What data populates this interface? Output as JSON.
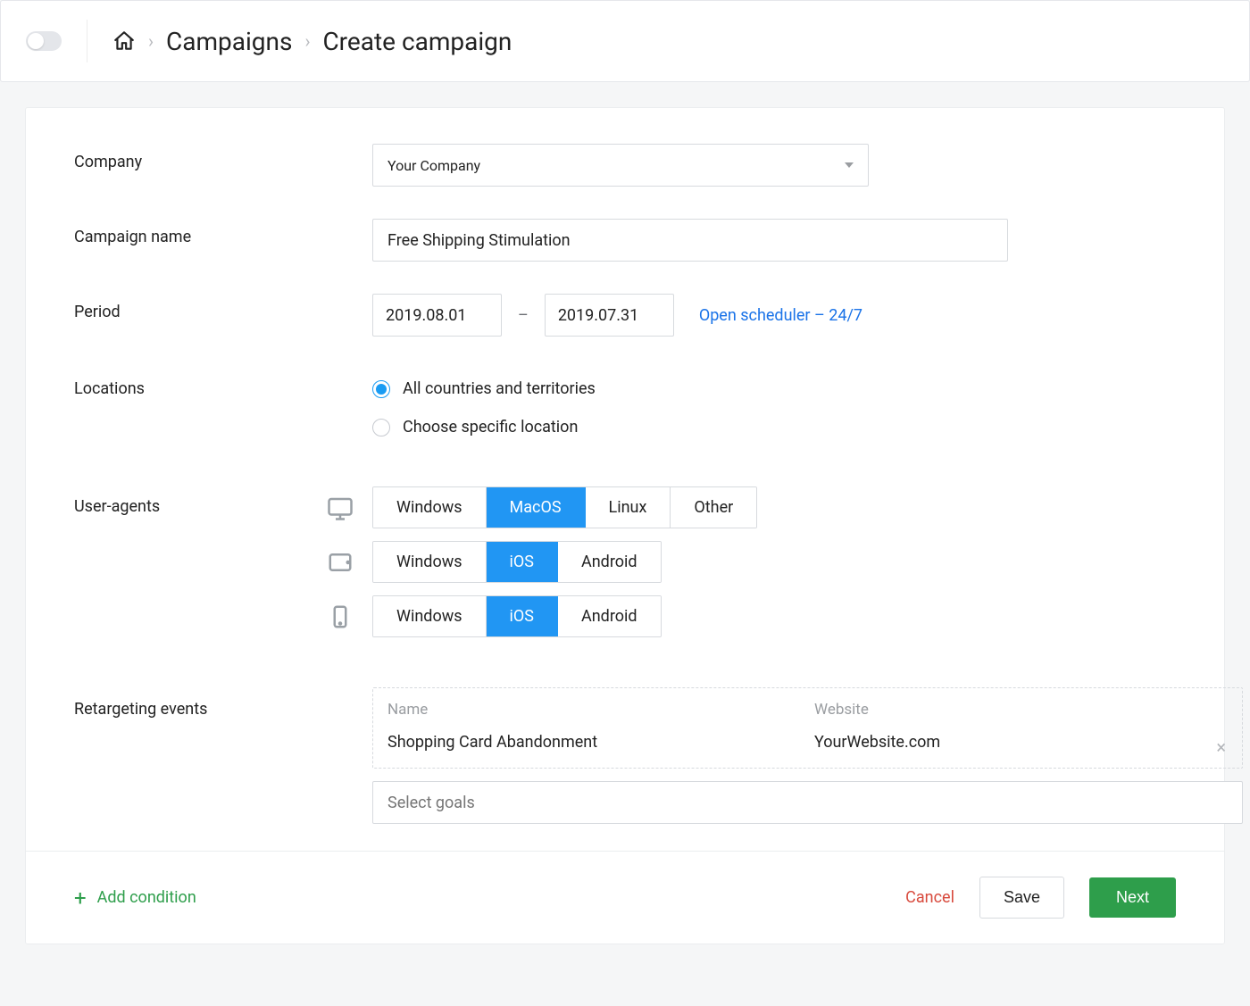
{
  "breadcrumb": {
    "campaigns": "Campaigns",
    "current": "Create campaign"
  },
  "labels": {
    "company": "Company",
    "campaign_name": "Campaign name",
    "period": "Period",
    "locations": "Locations",
    "user_agents": "User-agents",
    "retargeting_events": "Retargeting events"
  },
  "company_select": {
    "value": "Your Company"
  },
  "campaign_name_value": "Free Shipping Stimulation",
  "period": {
    "start": "2019.08.01",
    "end": "2019.07.31",
    "dash": "–",
    "scheduler_link": "Open scheduler – 24/7"
  },
  "locations": {
    "all_label": "All countries and territories",
    "specific_label": "Choose specific location",
    "selected": "all"
  },
  "user_agents": {
    "desktop": {
      "options": [
        "Windows",
        "MacOS",
        "Linux",
        "Other"
      ],
      "active": "MacOS"
    },
    "tablet": {
      "options": [
        "Windows",
        "iOS",
        "Android"
      ],
      "active": "iOS"
    },
    "mobile": {
      "options": [
        "Windows",
        "iOS",
        "Android"
      ],
      "active": "iOS"
    }
  },
  "retargeting": {
    "header_name": "Name",
    "header_website": "Website",
    "row_name": "Shopping Card Abandonment",
    "row_website": "YourWebsite.com",
    "goals_placeholder": "Select goals"
  },
  "footer": {
    "add_condition": "Add condition",
    "cancel": "Cancel",
    "save": "Save",
    "next": "Next"
  }
}
